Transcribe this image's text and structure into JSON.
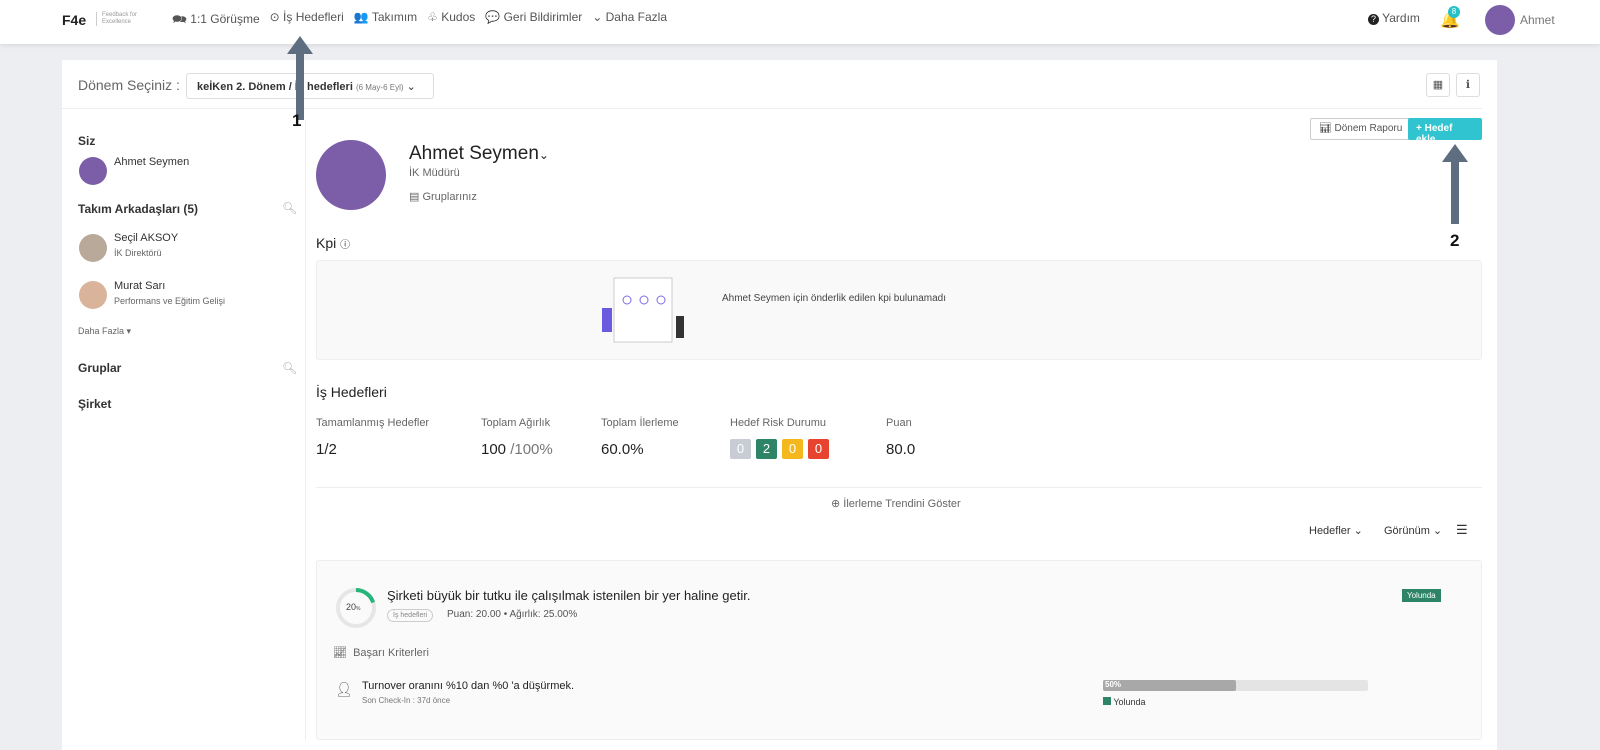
{
  "topbar": {
    "logo": "F4e",
    "logo_sub": "Feedback for Excellence",
    "nav": [
      {
        "label": "1:1 Görüşme",
        "icon": "chat-icon"
      },
      {
        "label": "İş Hedefleri",
        "icon": "target-icon"
      },
      {
        "label": "Takımım",
        "icon": "users-icon"
      },
      {
        "label": "Kudos",
        "icon": "award-icon"
      },
      {
        "label": "Geri Bildirimler",
        "icon": "comment-icon"
      },
      {
        "label": "Daha Fazla",
        "icon": "chevron-down-icon"
      }
    ],
    "help": "Yardım",
    "notif_count": "8",
    "user": "Ahmet"
  },
  "period": {
    "label": "Dönem Seçiniz :",
    "value": "keİKen 2. Dönem / İş hedefleri",
    "range": "(6 May-6 Eyl)"
  },
  "sidebar": {
    "you": "Siz",
    "me": "Ahmet Seymen",
    "team_title": "Takım Arkadaşları (5)",
    "team": [
      {
        "name": "Seçil AKSOY",
        "role": "İK Direktörü"
      },
      {
        "name": "Murat Sarı",
        "role": "Performans ve Eğitim Gelişi"
      }
    ],
    "more": "Daha Fazla",
    "groups": "Gruplar",
    "company": "Şirket"
  },
  "profile": {
    "name": "Ahmet Seymen",
    "title": "İK Müdürü",
    "groups": "Gruplarınız"
  },
  "actions": {
    "report": "Dönem Raporu",
    "add": "+ Hedef ekle"
  },
  "kpi": {
    "title": "Kpi",
    "empty": "Ahmet Seymen için önderlik edilen kpi bulunamadı"
  },
  "goals": {
    "title": "İş Hedefleri",
    "stats": [
      {
        "label": "Tamamlanmış Hedefler",
        "value": "1/2"
      },
      {
        "label": "Toplam Ağırlık",
        "value": "100",
        "suffix": " /100%"
      },
      {
        "label": "Toplam İlerleme",
        "value": "60.0%"
      },
      {
        "label": "Hedef Risk Durumu"
      },
      {
        "label": "Puan",
        "value": "80.0"
      }
    ],
    "risk": [
      {
        "v": "0",
        "c": "#c8ccd4"
      },
      {
        "v": "2",
        "c": "#2e8466"
      },
      {
        "v": "0",
        "c": "#f5b81c"
      },
      {
        "v": "0",
        "c": "#e8432e"
      }
    ],
    "trend": "İlerleme Trendini Göster",
    "filter1": "Hedefler",
    "filter2": "Görünüm"
  },
  "goal": {
    "progress": "20",
    "unit": "%",
    "title": "Şirketi büyük bir tutku ile çalışılmak istenilen bir yer haline getir.",
    "tag": "İş hedefleri",
    "meta": "Puan: 20.00 • Ağırlık: 25.00%",
    "status": "Yolunda",
    "criteria": "Başarı Kriterleri",
    "item": {
      "title": "Turnover oranını %10 dan %0 'a düşürmek.",
      "checkin": "Son Check-In : 37d önce",
      "progress": 50,
      "progress_label": "50%",
      "status": "Yolunda"
    }
  },
  "annotations": {
    "a1": "1",
    "a2": "2"
  }
}
